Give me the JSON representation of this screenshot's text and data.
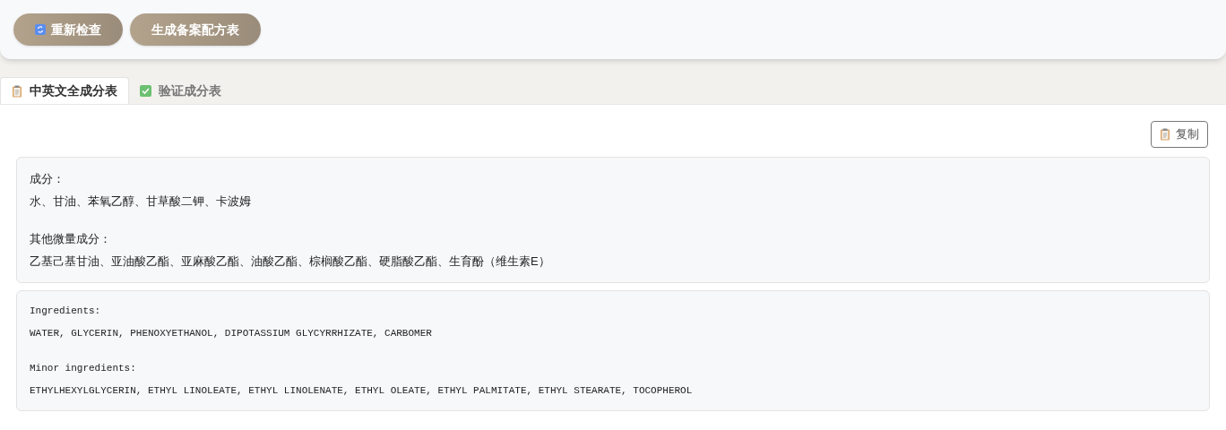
{
  "toolbar": {
    "buttons": [
      {
        "label": "重新检查",
        "kind": "refresh"
      },
      {
        "label": "生成备案配方表",
        "kind": "plain"
      }
    ]
  },
  "tabs": [
    {
      "label": "中英文全成分表",
      "kind": "clipboard",
      "selected": true
    },
    {
      "label": "验证成分表",
      "kind": "check",
      "selected": false
    }
  ],
  "copy_button": {
    "label": "复制"
  },
  "blocks": [
    {
      "kind": "chinese",
      "sections": [
        {
          "heading": "成分：",
          "text": "水、甘油、苯氧乙醇、甘草酸二钾、卡波姆"
        },
        {
          "heading": "其他微量成分：",
          "text": "乙基己基甘油、亚油酸乙酯、亚麻酸乙酯、油酸乙酯、棕榈酸乙酯、硬脂酸乙酯、生育酚（维生素E）"
        }
      ]
    },
    {
      "kind": "english",
      "sections": [
        {
          "heading": "Ingredients:",
          "text": "WATER, GLYCERIN, PHENOXYETHANOL, DIPOTASSIUM GLYCYRRHIZATE, CARBOMER"
        },
        {
          "heading": "Minor ingredients:",
          "text": "ETHYLHEXYLGLYCERIN, ETHYL LINOLEATE, ETHYL LINOLENATE, ETHYL OLEATE, ETHYL PALMITATE, ETHYL STEARATE, TOCOPHEROL"
        }
      ]
    }
  ]
}
